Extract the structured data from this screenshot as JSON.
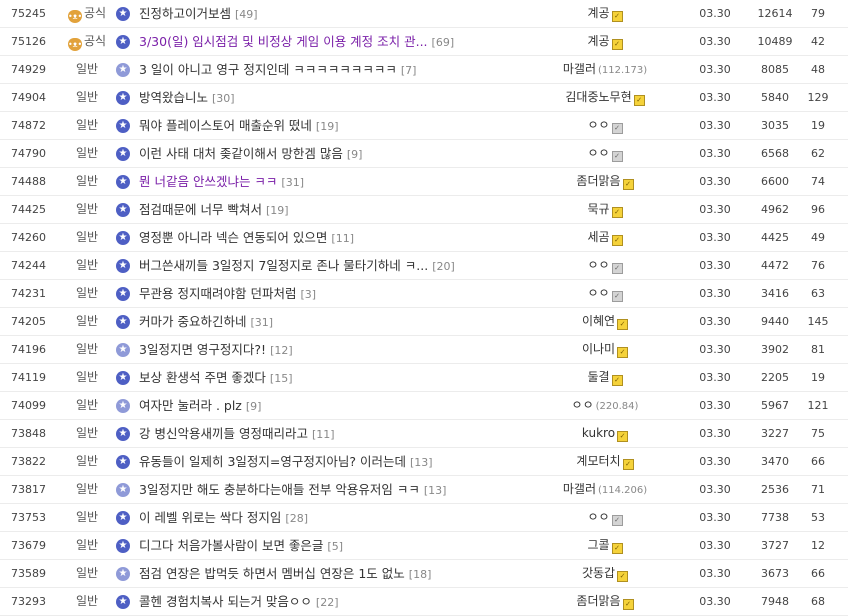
{
  "posts": [
    {
      "num": "75245",
      "head": "공식",
      "notice": true,
      "star": "dark",
      "title": "진정하고이거보셈",
      "comments": "[49]",
      "visited": false,
      "writer": "계공",
      "ip": "",
      "badge": "gold",
      "date": "03.30",
      "views": "12614",
      "recommend": "79"
    },
    {
      "num": "75126",
      "head": "공식",
      "notice": true,
      "star": "dark",
      "title": "3/30(일) 임시점검 및 비정상 게임 이용 계정 조치 관...",
      "comments": "[69]",
      "visited": true,
      "writer": "계공",
      "ip": "",
      "badge": "gold",
      "date": "03.30",
      "views": "10489",
      "recommend": "42"
    },
    {
      "num": "74929",
      "head": "일반",
      "notice": false,
      "star": "light",
      "title": "3 일이 아니고 영구 정지인데 ㅋㅋㅋㅋㅋㅋㅋㅋㅋ",
      "comments": "[7]",
      "visited": false,
      "writer": "마갤러",
      "ip": "(112.173)",
      "badge": "none",
      "date": "03.30",
      "views": "8085",
      "recommend": "48"
    },
    {
      "num": "74904",
      "head": "일반",
      "notice": false,
      "star": "dark",
      "title": "방역왔습니노",
      "comments": "[30]",
      "visited": false,
      "writer": "김대중노무현",
      "ip": "",
      "badge": "gold",
      "date": "03.30",
      "views": "5840",
      "recommend": "129"
    },
    {
      "num": "74872",
      "head": "일반",
      "notice": false,
      "star": "dark",
      "title": "뭐야 플레이스토어 매출순위 떴네",
      "comments": "[19]",
      "visited": false,
      "writer": "ㅇㅇ",
      "ip": "",
      "badge": "gray",
      "date": "03.30",
      "views": "3035",
      "recommend": "19"
    },
    {
      "num": "74790",
      "head": "일반",
      "notice": false,
      "star": "dark",
      "title": "이런 사태 대처 좆같이해서 망한겜 많음",
      "comments": "[9]",
      "visited": false,
      "writer": "ㅇㅇ",
      "ip": "",
      "badge": "gray",
      "date": "03.30",
      "views": "6568",
      "recommend": "62"
    },
    {
      "num": "74488",
      "head": "일반",
      "notice": false,
      "star": "dark",
      "title": "뭔 너같음 안쓰겠냐는 ㅋㅋ",
      "comments": "[31]",
      "visited": true,
      "writer": "좀더맑음",
      "ip": "",
      "badge": "gold",
      "date": "03.30",
      "views": "6600",
      "recommend": "74"
    },
    {
      "num": "74425",
      "head": "일반",
      "notice": false,
      "star": "dark",
      "title": "점검때문에 너무 빡쳐서",
      "comments": "[19]",
      "visited": false,
      "writer": "묵규",
      "ip": "",
      "badge": "gold",
      "date": "03.30",
      "views": "4962",
      "recommend": "96"
    },
    {
      "num": "74260",
      "head": "일반",
      "notice": false,
      "star": "dark",
      "title": "영정뿐 아니라 넥슨 연동되어 있으면",
      "comments": "[11]",
      "visited": false,
      "writer": "세곰",
      "ip": "",
      "badge": "gold",
      "date": "03.30",
      "views": "4425",
      "recommend": "49"
    },
    {
      "num": "74244",
      "head": "일반",
      "notice": false,
      "star": "dark",
      "title": "버그쓴새끼들 3일정지 7일정지로 존나 물타기하네 ㅋ...",
      "comments": "[20]",
      "visited": false,
      "writer": "ㅇㅇ",
      "ip": "",
      "badge": "gray",
      "date": "03.30",
      "views": "4472",
      "recommend": "76"
    },
    {
      "num": "74231",
      "head": "일반",
      "notice": false,
      "star": "dark",
      "title": "무관용 정지때려야함 던파처럼",
      "comments": "[3]",
      "visited": false,
      "writer": "ㅇㅇ",
      "ip": "",
      "badge": "gray",
      "date": "03.30",
      "views": "3416",
      "recommend": "63"
    },
    {
      "num": "74205",
      "head": "일반",
      "notice": false,
      "star": "dark",
      "title": "커마가 중요하긴하네",
      "comments": "[31]",
      "visited": false,
      "writer": "이혜연",
      "ip": "",
      "badge": "gold",
      "date": "03.30",
      "views": "9440",
      "recommend": "145"
    },
    {
      "num": "74196",
      "head": "일반",
      "notice": false,
      "star": "light",
      "title": "3일정지면 영구정지다?!",
      "comments": "[12]",
      "visited": false,
      "writer": "이나미",
      "ip": "",
      "badge": "gold",
      "date": "03.30",
      "views": "3902",
      "recommend": "81"
    },
    {
      "num": "74119",
      "head": "일반",
      "notice": false,
      "star": "dark",
      "title": "보상 환생석 주면 좋겠다",
      "comments": "[15]",
      "visited": false,
      "writer": "둘결",
      "ip": "",
      "badge": "gold",
      "date": "03.30",
      "views": "2205",
      "recommend": "19"
    },
    {
      "num": "74099",
      "head": "일반",
      "notice": false,
      "star": "light",
      "title": "여자만 눌러라 . plz",
      "comments": "[9]",
      "visited": false,
      "writer": "ㅇㅇ",
      "ip": "(220.84)",
      "badge": "none",
      "date": "03.30",
      "views": "5967",
      "recommend": "121"
    },
    {
      "num": "73848",
      "head": "일반",
      "notice": false,
      "star": "dark",
      "title": "강 병신악용새끼들 영정때리라고",
      "comments": "[11]",
      "visited": false,
      "writer": "kukro",
      "ip": "",
      "badge": "gold",
      "date": "03.30",
      "views": "3227",
      "recommend": "75"
    },
    {
      "num": "73822",
      "head": "일반",
      "notice": false,
      "star": "dark",
      "title": "유동들이 일제히 3일정지=영구정지아님? 이러는데",
      "comments": "[13]",
      "visited": false,
      "writer": "계모터치",
      "ip": "",
      "badge": "gold",
      "date": "03.30",
      "views": "3470",
      "recommend": "66"
    },
    {
      "num": "73817",
      "head": "일반",
      "notice": false,
      "star": "light",
      "title": "3일정지만 해도 충분하다는애들 전부 악용유저임 ㅋㅋ",
      "comments": "[13]",
      "visited": false,
      "writer": "마갤러",
      "ip": "(114.206)",
      "badge": "none",
      "date": "03.30",
      "views": "2536",
      "recommend": "71"
    },
    {
      "num": "73753",
      "head": "일반",
      "notice": false,
      "star": "dark",
      "title": "이 레벨 위로는 싹다 정지임",
      "comments": "[28]",
      "visited": false,
      "writer": "ㅇㅇ",
      "ip": "",
      "badge": "gray",
      "date": "03.30",
      "views": "7738",
      "recommend": "53"
    },
    {
      "num": "73679",
      "head": "일반",
      "notice": false,
      "star": "dark",
      "title": "디그다 처음가볼사람이 보면 좋은글",
      "comments": "[5]",
      "visited": false,
      "writer": "그콜",
      "ip": "",
      "badge": "gold",
      "date": "03.30",
      "views": "3727",
      "recommend": "12"
    },
    {
      "num": "73589",
      "head": "일반",
      "notice": false,
      "star": "light",
      "title": "점검 연장은 밥먹듯 하면서 멤버십 연장은 1도 없노",
      "comments": "[18]",
      "visited": false,
      "writer": "갓동갑",
      "ip": "",
      "badge": "gold",
      "date": "03.30",
      "views": "3673",
      "recommend": "66"
    },
    {
      "num": "73293",
      "head": "일반",
      "notice": false,
      "star": "dark",
      "title": "콜헨 경험치복사 되는거 맞음ㅇㅇ",
      "comments": "[22]",
      "visited": false,
      "writer": "좀더맑음",
      "ip": "",
      "badge": "gold",
      "date": "03.30",
      "views": "7948",
      "recommend": "68"
    }
  ]
}
